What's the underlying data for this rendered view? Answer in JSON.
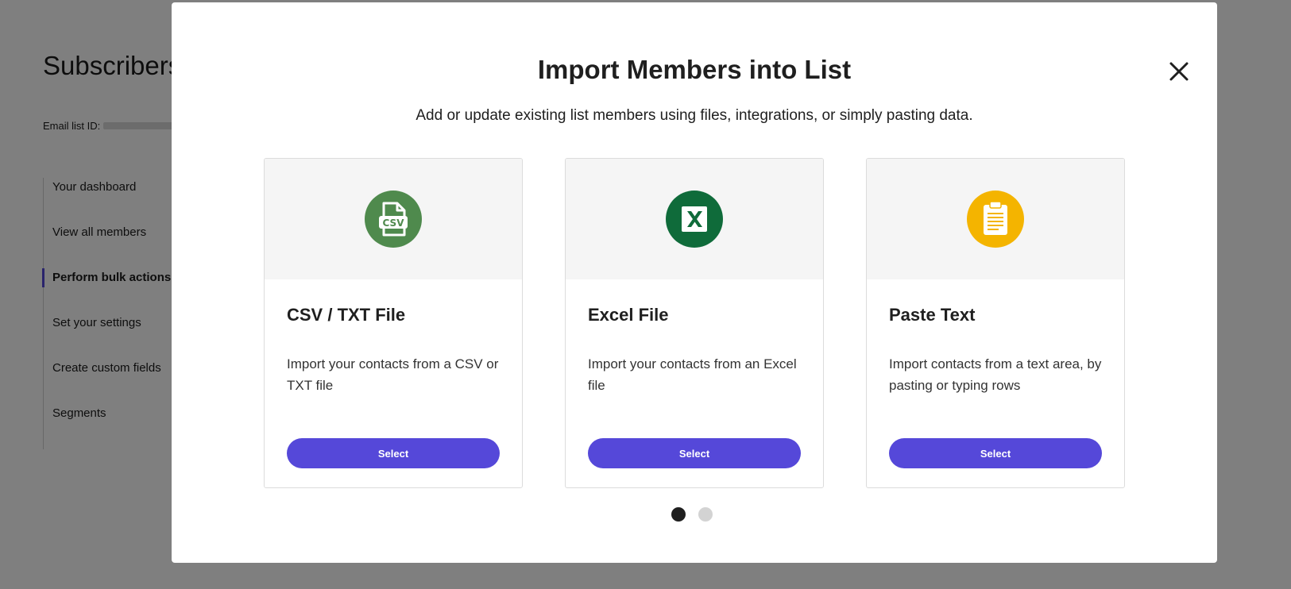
{
  "background": {
    "title": "Subscribers",
    "list_id_label": "Email list ID:",
    "nav": [
      {
        "label": "Your dashboard"
      },
      {
        "label": "View all members"
      },
      {
        "label": "Perform bulk actions"
      },
      {
        "label": "Set your settings"
      },
      {
        "label": "Create custom fields"
      },
      {
        "label": "Segments"
      }
    ],
    "active_nav": "Perform bulk actions"
  },
  "modal": {
    "title": "Import Members into List",
    "subtitle": "Add or update existing list members using files, integrations, or simply pasting data.",
    "close_icon": "close-icon",
    "cards": [
      {
        "icon": "csv-file-icon",
        "icon_color": "#4f8a4d",
        "title": "CSV / TXT File",
        "description": "Import your contacts from a CSV or TXT file",
        "button_label": "Select"
      },
      {
        "icon": "excel-file-icon",
        "icon_color": "#0f6b3a",
        "title": "Excel File",
        "description": "Import your contacts from an Excel file",
        "button_label": "Select"
      },
      {
        "icon": "clipboard-icon",
        "icon_color": "#f4b400",
        "title": "Paste Text",
        "description": "Import contacts from a text area, by pasting or typing rows",
        "button_label": "Select"
      }
    ],
    "pagination": {
      "current_page": 1,
      "total_pages": 2
    }
  },
  "colors": {
    "accent": "#5548d9",
    "overlay": "rgba(0,0,0,0.5)"
  }
}
